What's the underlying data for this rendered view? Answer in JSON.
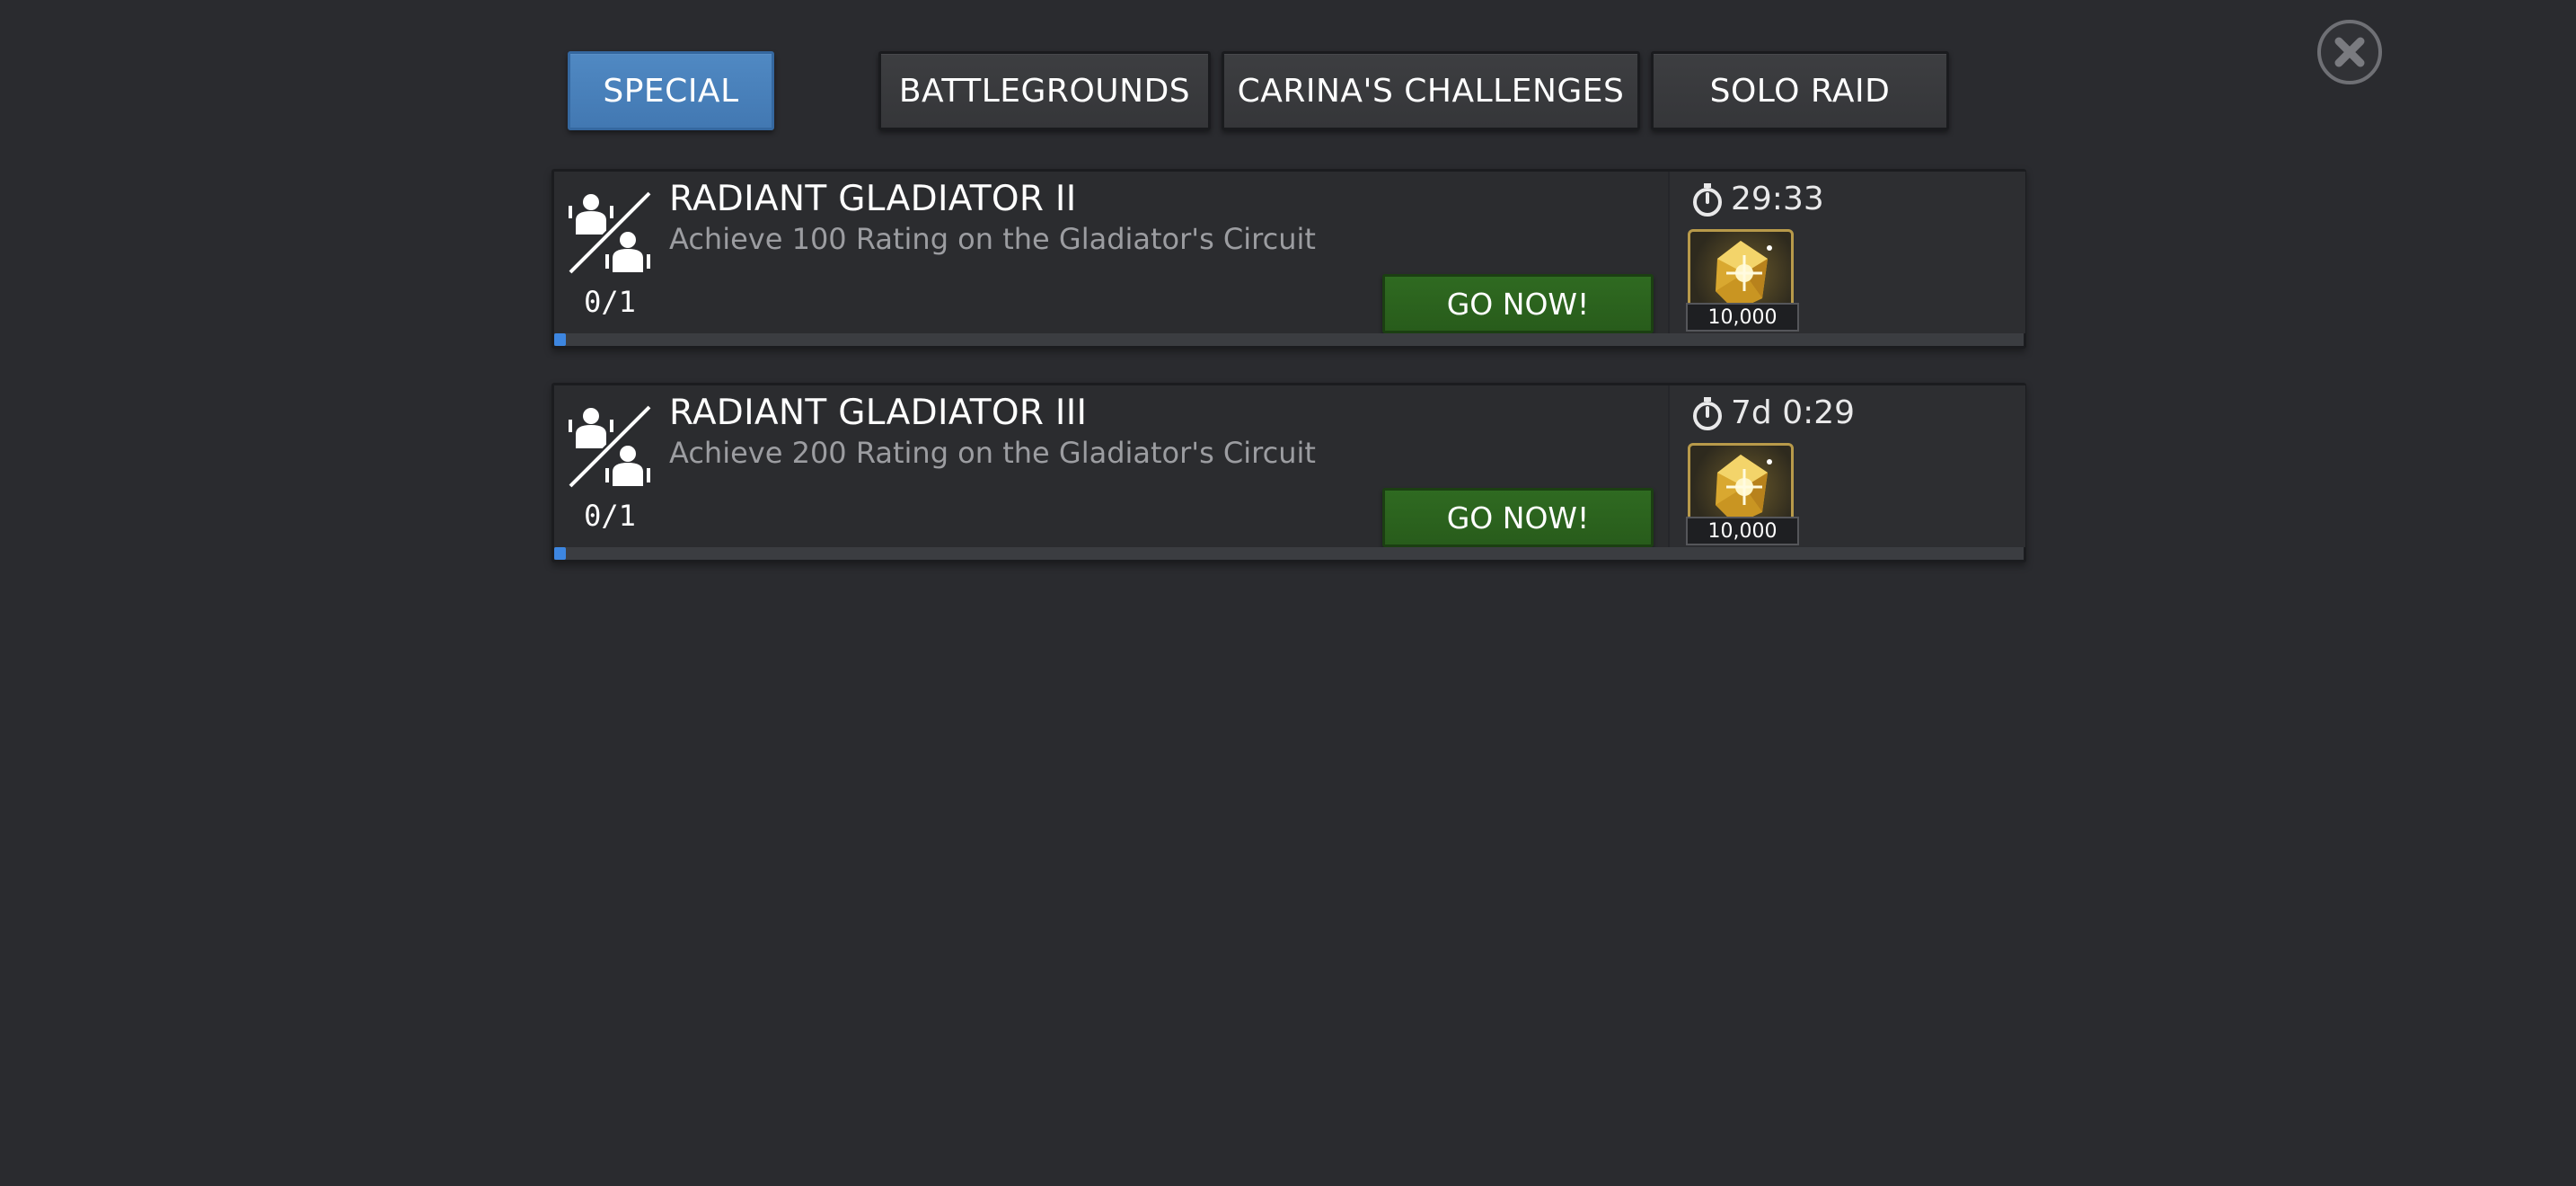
{
  "tabs": [
    {
      "label": "SPECIAL",
      "active": true
    },
    {
      "label": "BATTLEGROUNDS",
      "active": false
    },
    {
      "label": "CARINA'S CHALLENGES",
      "active": false
    },
    {
      "label": "SOLO RAID",
      "active": false
    }
  ],
  "close_icon": "close-circle-icon",
  "quests": [
    {
      "title": "RADIANT GLADIATOR II",
      "description": "Achieve 100 Rating on the Gladiator's Circuit",
      "progress_text": "0/1",
      "progress_fraction": 0,
      "button_label": "GO NOW!",
      "timer": "29:33",
      "reward_icon": "gold-crystal-icon",
      "reward_amount": "10,000"
    },
    {
      "title": "RADIANT GLADIATOR III",
      "description": "Achieve 200 Rating on the Gladiator's Circuit",
      "progress_text": "0/1",
      "progress_fraction": 0,
      "button_label": "GO NOW!",
      "timer": "7d 0:29",
      "reward_icon": "gold-crystal-icon",
      "reward_amount": "10,000"
    }
  ],
  "colors": {
    "background": "#2a2b2f",
    "active_tab": "#4a82bd",
    "go_button": "#2d6620",
    "progress": "#3d86e0",
    "reward_border": "#b89a4a"
  }
}
